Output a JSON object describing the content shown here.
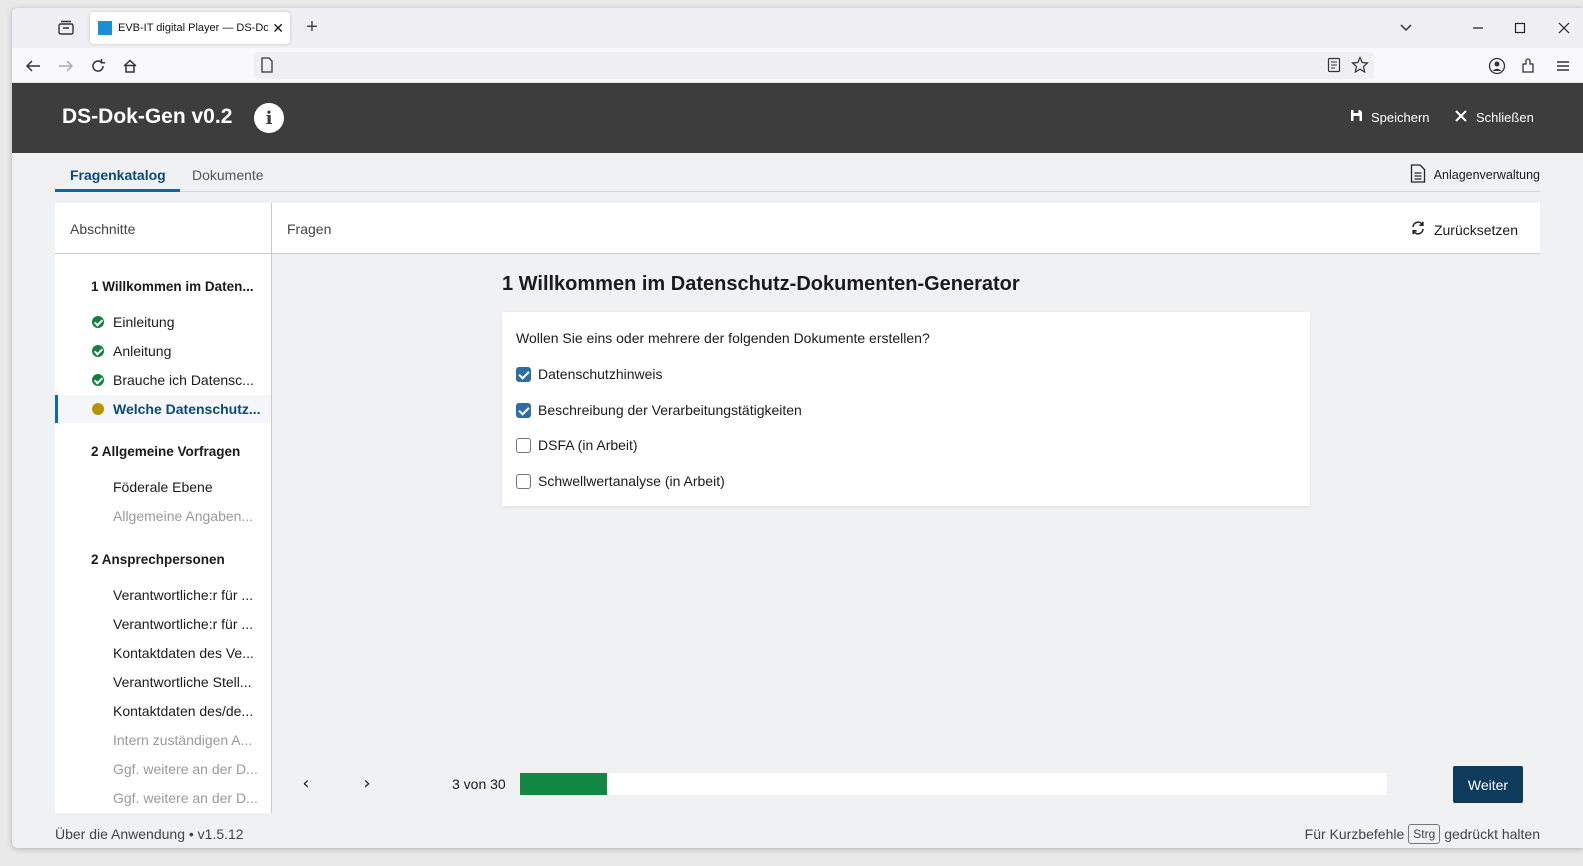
{
  "browser": {
    "tab_title": "EVB-IT digital Player — DS-Dok",
    "tab_close": "✕",
    "new_tab": "+",
    "favicon_color": "#1a8fd8"
  },
  "header": {
    "app_title": "DS-Dok-Gen v0.2",
    "info_icon": "i",
    "save_label": "Speichern",
    "close_label": "Schließen",
    "background": "#3d3d3d"
  },
  "tabs": {
    "items": [
      {
        "label": "Fragenkatalog",
        "active": true
      },
      {
        "label": "Dokumente",
        "active": false
      }
    ],
    "attachments_label": "Anlagenverwaltung"
  },
  "panel": {
    "sections_heading": "Abschnitte",
    "questions_heading": "Fragen",
    "reset_label": "Zurücksetzen"
  },
  "sidebar": {
    "sections": [
      {
        "title": "1 Willkommen im Daten...",
        "items": [
          {
            "label": "Einleitung",
            "status": "done"
          },
          {
            "label": "Anleitung",
            "status": "done"
          },
          {
            "label": "Brauche ich Datensc...",
            "status": "done"
          },
          {
            "label": "Welche Datenschutz...",
            "status": "current"
          }
        ]
      },
      {
        "title": "2 Allgemeine Vorfragen",
        "items": [
          {
            "label": "Föderale Ebene",
            "status": "open"
          },
          {
            "label": "Allgemeine Angaben...",
            "status": "disabled"
          }
        ]
      },
      {
        "title": "2 Ansprechpersonen",
        "items": [
          {
            "label": "Verantwortliche:r für ...",
            "status": "open"
          },
          {
            "label": "Verantwortliche:r für ...",
            "status": "open"
          },
          {
            "label": "Kontaktdaten des Ve...",
            "status": "open"
          },
          {
            "label": "Verantwortliche Stell...",
            "status": "open"
          },
          {
            "label": "Kontaktdaten des/de...",
            "status": "open"
          },
          {
            "label": "Intern zuständigen A...",
            "status": "disabled"
          },
          {
            "label": "Ggf. weitere an der D...",
            "status": "disabled"
          },
          {
            "label": "Ggf. weitere an der D...",
            "status": "disabled"
          }
        ]
      }
    ]
  },
  "question": {
    "title": "1 Willkommen im Datenschutz-Dokumenten-Generator",
    "prompt": "Wollen Sie eins oder mehrere der folgenden Dokumente erstellen?",
    "options": [
      {
        "label": "Datenschutzhinweis",
        "checked": true
      },
      {
        "label": "Beschreibung der Verarbeitungstätigkeiten",
        "checked": true
      },
      {
        "label": "DSFA (in Arbeit)",
        "checked": false
      },
      {
        "label": "Schwellwertanalyse (in Arbeit)",
        "checked": false
      }
    ]
  },
  "pager": {
    "prev": "‹",
    "next_arrow": "›",
    "count_text": "3 von 30",
    "progress_fraction": 0.1,
    "progress_color": "#128743",
    "next_label": "Weiter",
    "next_color": "#0e3a5c"
  },
  "footer": {
    "left": "Über die Anwendung • v1.5.12",
    "right_prefix": "Für Kurzbefehle",
    "key": "Strg",
    "right_suffix": "gedrückt halten"
  }
}
